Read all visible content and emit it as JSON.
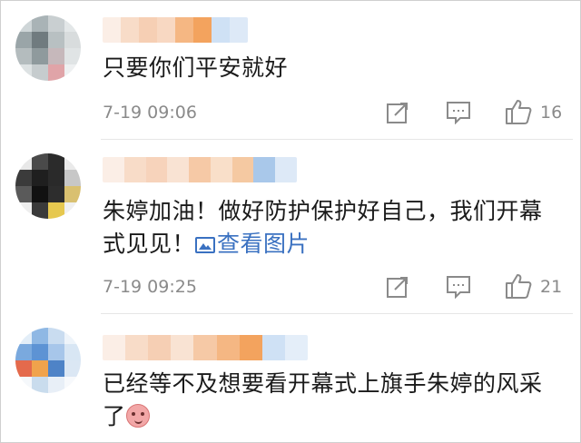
{
  "comments": [
    {
      "text": "只要你们平安就好",
      "time": "7-19 09:06",
      "likes": "16"
    },
    {
      "text_line1": "朱婷加油！做好防护保护好自己，我们开幕",
      "text_line2": "式见见！",
      "link": "查看图片",
      "time": "7-19 09:25",
      "likes": "21"
    },
    {
      "text_line1": "已经等不及想要看开幕式上旗手朱婷的风采",
      "text_line2": "了"
    }
  ],
  "icons": {
    "share": "share-icon",
    "comment": "comment-icon",
    "like": "thumbs-up-icon",
    "image": "image-icon",
    "emoji": "emoji-icon"
  },
  "colors": {
    "link": "#3a71c1",
    "meta": "#8a8a8a"
  }
}
